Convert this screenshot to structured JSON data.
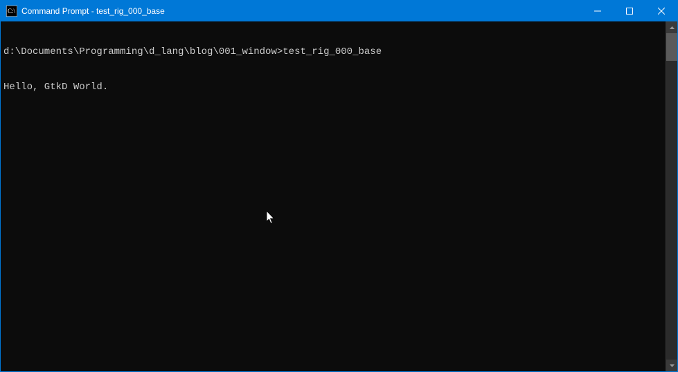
{
  "titlebar": {
    "title": "Command Prompt - test_rig_000_base"
  },
  "terminal": {
    "lines": [
      {
        "prompt": "d:\\Documents\\Programming\\d_lang\\blog\\001_window>",
        "command": "test_rig_000_base"
      },
      {
        "output": "Hello, GtkD World."
      }
    ]
  },
  "colors": {
    "titlebar_bg": "#0078d7",
    "terminal_bg": "#0c0c0c",
    "terminal_fg": "#cccccc"
  }
}
